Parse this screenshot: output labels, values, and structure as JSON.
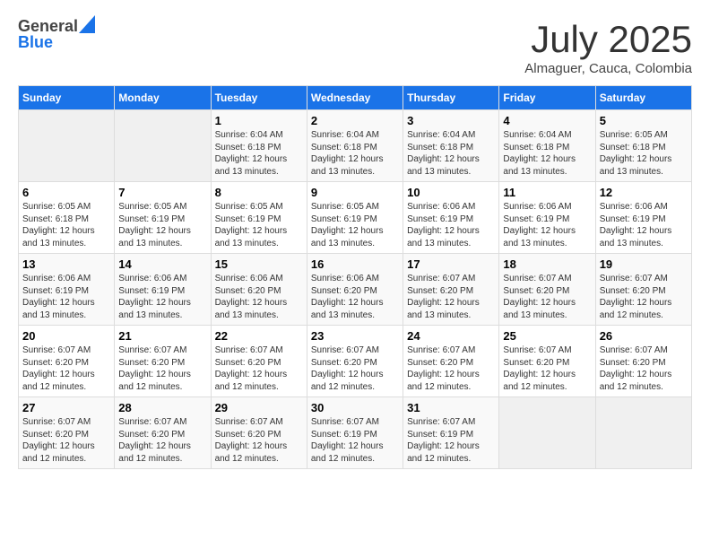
{
  "logo": {
    "line1": "General",
    "line2": "Blue"
  },
  "title": "July 2025",
  "subtitle": "Almaguer, Cauca, Colombia",
  "days_header": [
    "Sunday",
    "Monday",
    "Tuesday",
    "Wednesday",
    "Thursday",
    "Friday",
    "Saturday"
  ],
  "weeks": [
    [
      {
        "day": "",
        "empty": true
      },
      {
        "day": "",
        "empty": true
      },
      {
        "day": "1",
        "sunrise": "Sunrise: 6:04 AM",
        "sunset": "Sunset: 6:18 PM",
        "daylight": "Daylight: 12 hours and 13 minutes."
      },
      {
        "day": "2",
        "sunrise": "Sunrise: 6:04 AM",
        "sunset": "Sunset: 6:18 PM",
        "daylight": "Daylight: 12 hours and 13 minutes."
      },
      {
        "day": "3",
        "sunrise": "Sunrise: 6:04 AM",
        "sunset": "Sunset: 6:18 PM",
        "daylight": "Daylight: 12 hours and 13 minutes."
      },
      {
        "day": "4",
        "sunrise": "Sunrise: 6:04 AM",
        "sunset": "Sunset: 6:18 PM",
        "daylight": "Daylight: 12 hours and 13 minutes."
      },
      {
        "day": "5",
        "sunrise": "Sunrise: 6:05 AM",
        "sunset": "Sunset: 6:18 PM",
        "daylight": "Daylight: 12 hours and 13 minutes."
      }
    ],
    [
      {
        "day": "6",
        "sunrise": "Sunrise: 6:05 AM",
        "sunset": "Sunset: 6:18 PM",
        "daylight": "Daylight: 12 hours and 13 minutes."
      },
      {
        "day": "7",
        "sunrise": "Sunrise: 6:05 AM",
        "sunset": "Sunset: 6:19 PM",
        "daylight": "Daylight: 12 hours and 13 minutes."
      },
      {
        "day": "8",
        "sunrise": "Sunrise: 6:05 AM",
        "sunset": "Sunset: 6:19 PM",
        "daylight": "Daylight: 12 hours and 13 minutes."
      },
      {
        "day": "9",
        "sunrise": "Sunrise: 6:05 AM",
        "sunset": "Sunset: 6:19 PM",
        "daylight": "Daylight: 12 hours and 13 minutes."
      },
      {
        "day": "10",
        "sunrise": "Sunrise: 6:06 AM",
        "sunset": "Sunset: 6:19 PM",
        "daylight": "Daylight: 12 hours and 13 minutes."
      },
      {
        "day": "11",
        "sunrise": "Sunrise: 6:06 AM",
        "sunset": "Sunset: 6:19 PM",
        "daylight": "Daylight: 12 hours and 13 minutes."
      },
      {
        "day": "12",
        "sunrise": "Sunrise: 6:06 AM",
        "sunset": "Sunset: 6:19 PM",
        "daylight": "Daylight: 12 hours and 13 minutes."
      }
    ],
    [
      {
        "day": "13",
        "sunrise": "Sunrise: 6:06 AM",
        "sunset": "Sunset: 6:19 PM",
        "daylight": "Daylight: 12 hours and 13 minutes."
      },
      {
        "day": "14",
        "sunrise": "Sunrise: 6:06 AM",
        "sunset": "Sunset: 6:19 PM",
        "daylight": "Daylight: 12 hours and 13 minutes."
      },
      {
        "day": "15",
        "sunrise": "Sunrise: 6:06 AM",
        "sunset": "Sunset: 6:20 PM",
        "daylight": "Daylight: 12 hours and 13 minutes."
      },
      {
        "day": "16",
        "sunrise": "Sunrise: 6:06 AM",
        "sunset": "Sunset: 6:20 PM",
        "daylight": "Daylight: 12 hours and 13 minutes."
      },
      {
        "day": "17",
        "sunrise": "Sunrise: 6:07 AM",
        "sunset": "Sunset: 6:20 PM",
        "daylight": "Daylight: 12 hours and 13 minutes."
      },
      {
        "day": "18",
        "sunrise": "Sunrise: 6:07 AM",
        "sunset": "Sunset: 6:20 PM",
        "daylight": "Daylight: 12 hours and 13 minutes."
      },
      {
        "day": "19",
        "sunrise": "Sunrise: 6:07 AM",
        "sunset": "Sunset: 6:20 PM",
        "daylight": "Daylight: 12 hours and 12 minutes."
      }
    ],
    [
      {
        "day": "20",
        "sunrise": "Sunrise: 6:07 AM",
        "sunset": "Sunset: 6:20 PM",
        "daylight": "Daylight: 12 hours and 12 minutes."
      },
      {
        "day": "21",
        "sunrise": "Sunrise: 6:07 AM",
        "sunset": "Sunset: 6:20 PM",
        "daylight": "Daylight: 12 hours and 12 minutes."
      },
      {
        "day": "22",
        "sunrise": "Sunrise: 6:07 AM",
        "sunset": "Sunset: 6:20 PM",
        "daylight": "Daylight: 12 hours and 12 minutes."
      },
      {
        "day": "23",
        "sunrise": "Sunrise: 6:07 AM",
        "sunset": "Sunset: 6:20 PM",
        "daylight": "Daylight: 12 hours and 12 minutes."
      },
      {
        "day": "24",
        "sunrise": "Sunrise: 6:07 AM",
        "sunset": "Sunset: 6:20 PM",
        "daylight": "Daylight: 12 hours and 12 minutes."
      },
      {
        "day": "25",
        "sunrise": "Sunrise: 6:07 AM",
        "sunset": "Sunset: 6:20 PM",
        "daylight": "Daylight: 12 hours and 12 minutes."
      },
      {
        "day": "26",
        "sunrise": "Sunrise: 6:07 AM",
        "sunset": "Sunset: 6:20 PM",
        "daylight": "Daylight: 12 hours and 12 minutes."
      }
    ],
    [
      {
        "day": "27",
        "sunrise": "Sunrise: 6:07 AM",
        "sunset": "Sunset: 6:20 PM",
        "daylight": "Daylight: 12 hours and 12 minutes."
      },
      {
        "day": "28",
        "sunrise": "Sunrise: 6:07 AM",
        "sunset": "Sunset: 6:20 PM",
        "daylight": "Daylight: 12 hours and 12 minutes."
      },
      {
        "day": "29",
        "sunrise": "Sunrise: 6:07 AM",
        "sunset": "Sunset: 6:20 PM",
        "daylight": "Daylight: 12 hours and 12 minutes."
      },
      {
        "day": "30",
        "sunrise": "Sunrise: 6:07 AM",
        "sunset": "Sunset: 6:19 PM",
        "daylight": "Daylight: 12 hours and 12 minutes."
      },
      {
        "day": "31",
        "sunrise": "Sunrise: 6:07 AM",
        "sunset": "Sunset: 6:19 PM",
        "daylight": "Daylight: 12 hours and 12 minutes."
      },
      {
        "day": "",
        "empty": true
      },
      {
        "day": "",
        "empty": true
      }
    ]
  ]
}
